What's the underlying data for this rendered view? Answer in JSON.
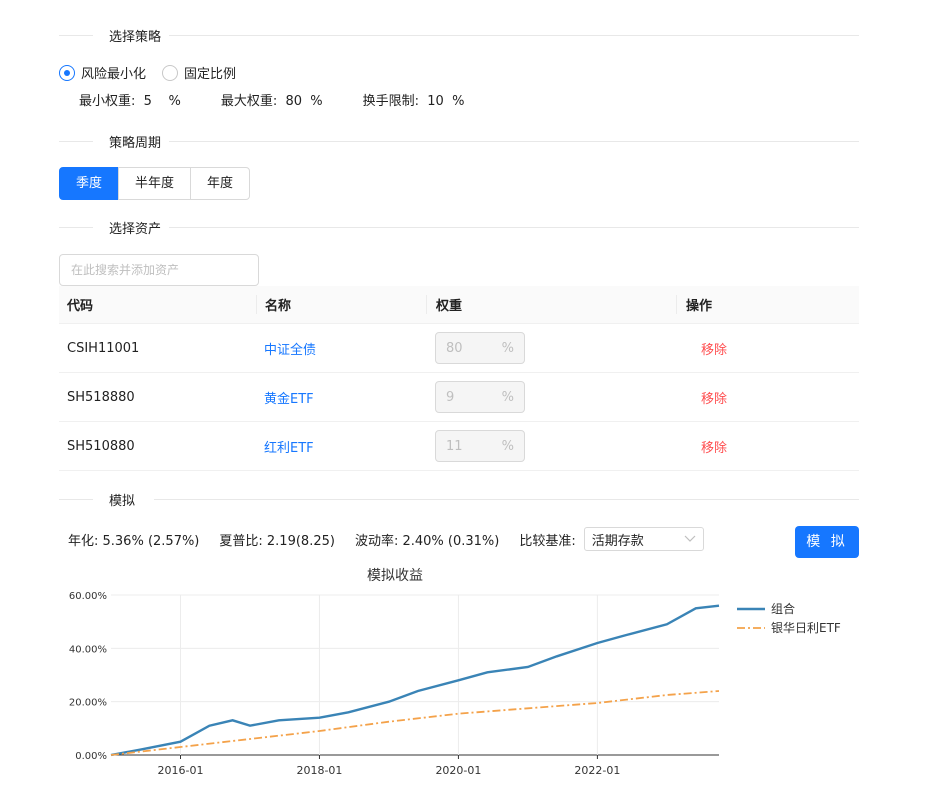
{
  "sections": {
    "strategy": "选择策略",
    "period": "策略周期",
    "assets": "选择资产",
    "simulate": "模拟"
  },
  "strategy": {
    "options": [
      {
        "label": "风险最小化",
        "checked": true
      },
      {
        "label": "固定比例",
        "checked": false
      }
    ],
    "min_weight": "最小权重:  5    %",
    "max_weight": "最大权重:  80  %",
    "turnover": "换手限制:  10  %"
  },
  "period": {
    "options": [
      "季度",
      "半年度",
      "年度"
    ],
    "active": "季度"
  },
  "search": {
    "placeholder": "在此搜索并添加资产"
  },
  "table": {
    "headers": [
      "代码",
      "名称",
      "权重",
      "操作"
    ],
    "rows": [
      {
        "code": "CSIH11001",
        "name": "中证全债",
        "weight": "80",
        "unit": "%",
        "action": "移除"
      },
      {
        "code": "SH518880",
        "name": "黄金ETF",
        "weight": "9",
        "unit": "%",
        "action": "移除"
      },
      {
        "code": "SH510880",
        "name": "红利ETF",
        "weight": "11",
        "unit": "%",
        "action": "移除"
      }
    ]
  },
  "stats": {
    "annual": "年化: 5.36% (2.57%)",
    "sharpe": "夏普比: 2.19(8.25)",
    "volatility": "波动率: 2.40% (0.31%)",
    "benchmark_label": "比较基准:",
    "benchmark_value": "活期存款"
  },
  "simulate_button": "模 拟",
  "colors": {
    "accent": "#1677ff",
    "series1": "#3a84b6",
    "series2": "#f4a24a",
    "danger": "#ff4d4f"
  },
  "chart_data": {
    "type": "line",
    "title": "模拟收益",
    "xlabel": "",
    "ylabel": "",
    "xlim": [
      "2015-01",
      "2023-10"
    ],
    "ylim": [
      0,
      60
    ],
    "y_ticks": [
      "0.00%",
      "20.00%",
      "40.00%",
      "60.00%"
    ],
    "x_ticks": [
      "2016-01",
      "2018-01",
      "2020-01",
      "2022-01"
    ],
    "grid": true,
    "legend": "top-right",
    "series": [
      {
        "name": "组合",
        "x": [
          "2015-01",
          "2015-06",
          "2016-01",
          "2016-06",
          "2016-10",
          "2017-01",
          "2017-06",
          "2018-01",
          "2018-06",
          "2019-01",
          "2019-06",
          "2020-01",
          "2020-06",
          "2021-01",
          "2021-06",
          "2022-01",
          "2022-06",
          "2023-01",
          "2023-06",
          "2023-10"
        ],
        "values": [
          0,
          2,
          5,
          11,
          13,
          11,
          13,
          14,
          16,
          20,
          24,
          28,
          31,
          33,
          37,
          42,
          45,
          49,
          55,
          56
        ]
      },
      {
        "name": "银华日利ETF",
        "x": [
          "2015-01",
          "2016-01",
          "2017-01",
          "2018-01",
          "2019-01",
          "2020-01",
          "2021-01",
          "2022-01",
          "2023-01",
          "2023-10"
        ],
        "values": [
          0,
          3,
          6,
          9,
          12.5,
          15.5,
          17.5,
          19.5,
          22.5,
          24
        ]
      }
    ]
  }
}
